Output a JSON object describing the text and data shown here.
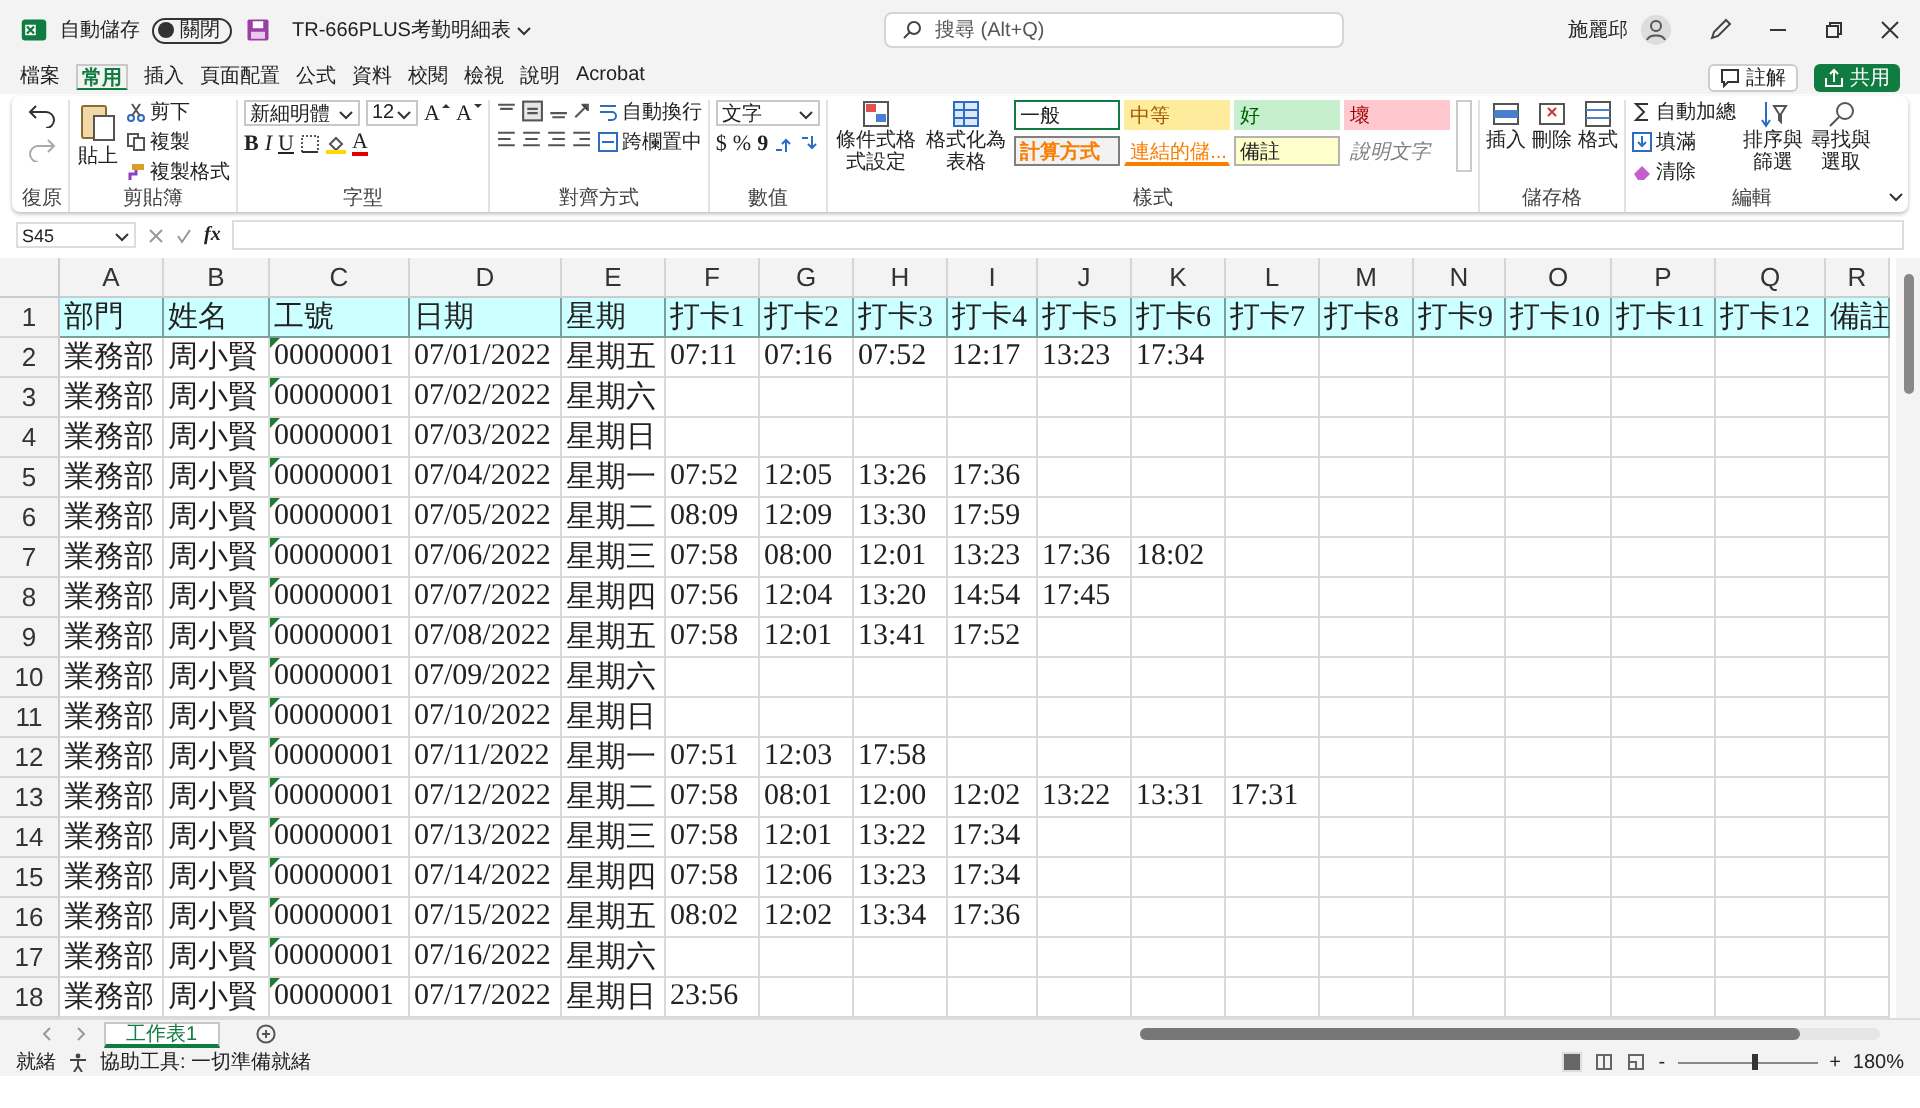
{
  "title_bar": {
    "autosave": {
      "label": "自動儲存",
      "on": false,
      "state_text": "關閉"
    },
    "filename": "TR-666PLUS考勤明細表",
    "search": {
      "placeholder": "搜尋 (Alt+Q)"
    },
    "user_name": "施麗邱"
  },
  "menu_tabs": [
    {
      "label": "檔案",
      "selected": false
    },
    {
      "label": "常用",
      "selected": true
    },
    {
      "label": "插入",
      "selected": false
    },
    {
      "label": "頁面配置",
      "selected": false
    },
    {
      "label": "公式",
      "selected": false
    },
    {
      "label": "資料",
      "selected": false
    },
    {
      "label": "校閱",
      "selected": false
    },
    {
      "label": "檢視",
      "selected": false
    },
    {
      "label": "說明",
      "selected": false
    },
    {
      "label": "Acrobat",
      "selected": false
    }
  ],
  "comments_button": "註解",
  "share_button": "共用",
  "ribbon": {
    "undo": {
      "label": "復原"
    },
    "clipboard": {
      "paste": "貼上",
      "cut": "剪下",
      "copy": "複製",
      "format_painter": "複製格式",
      "label": "剪貼簿"
    },
    "font": {
      "name": "新細明體",
      "size": "12",
      "grow": "A",
      "shrink": "A",
      "bold": "B",
      "italic": "I",
      "underline": "U",
      "font_color": "A",
      "label": "字型"
    },
    "alignment": {
      "wrap_text": "自動換行",
      "merge_center": "跨欄置中",
      "label": "對齊方式"
    },
    "number": {
      "format": "文字",
      "currency": "$",
      "percent": "%",
      "comma": "9",
      "label": "數值"
    },
    "styles": {
      "conditional": "條件式格式設定",
      "as_table": "格式化為表格",
      "label": "樣式",
      "gallery": [
        {
          "label": "一般",
          "kind": "normal",
          "selected": true
        },
        {
          "label": "中等",
          "kind": "neutral",
          "selected": false
        },
        {
          "label": "好",
          "kind": "good",
          "selected": false
        },
        {
          "label": "壞",
          "kind": "bad",
          "selected": false
        },
        {
          "label": "計算方式",
          "kind": "calculation",
          "selected": false
        },
        {
          "label": "連結的儲...",
          "kind": "linked",
          "selected": false
        },
        {
          "label": "備註",
          "kind": "note",
          "selected": false
        },
        {
          "label": "說明文字",
          "kind": "explanatory",
          "selected": false
        }
      ]
    },
    "cells": {
      "insert": "插入",
      "delete": "刪除",
      "format": "格式",
      "label": "儲存格"
    },
    "editing": {
      "autosum": "自動加總",
      "fill": "填滿",
      "clear": "清除",
      "sort_filter": "排序與篩選",
      "find_select": "尋找與選取",
      "label": "編輯"
    }
  },
  "formula_bar": {
    "name_box": "S45",
    "function_label": "fx"
  },
  "sheet": {
    "columns": [
      {
        "label": "A",
        "flagged": false
      },
      {
        "label": "B",
        "flagged": false
      },
      {
        "label": "C",
        "flagged": true
      },
      {
        "label": "D",
        "flagged": false
      },
      {
        "label": "E",
        "flagged": false
      },
      {
        "label": "F",
        "flagged": false
      },
      {
        "label": "G",
        "flagged": false
      },
      {
        "label": "H",
        "flagged": false
      },
      {
        "label": "I",
        "flagged": false
      },
      {
        "label": "J",
        "flagged": false
      },
      {
        "label": "K",
        "flagged": false
      },
      {
        "label": "L",
        "flagged": false
      },
      {
        "label": "M",
        "flagged": false
      },
      {
        "label": "N",
        "flagged": false
      },
      {
        "label": "O",
        "flagged": false
      },
      {
        "label": "P",
        "flagged": false
      },
      {
        "label": "Q",
        "flagged": false
      },
      {
        "label": "R",
        "flagged": false
      }
    ],
    "rows": [
      {
        "number": "1",
        "highlighted": true,
        "cells": [
          "部門",
          "姓名",
          "工號",
          "日期",
          "星期",
          "打卡1",
          "打卡2",
          "打卡3",
          "打卡4",
          "打卡5",
          "打卡6",
          "打卡7",
          "打卡8",
          "打卡9",
          "打卡10",
          "打卡11",
          "打卡12",
          "備註"
        ]
      },
      {
        "number": "2",
        "highlighted": false,
        "cells": [
          "業務部",
          "周小賢",
          "00000001",
          "07/01/2022",
          "星期五",
          "07:11",
          "07:16",
          "07:52",
          "12:17",
          "13:23",
          "17:34"
        ]
      },
      {
        "number": "3",
        "highlighted": false,
        "cells": [
          "業務部",
          "周小賢",
          "00000001",
          "07/02/2022",
          "星期六"
        ]
      },
      {
        "number": "4",
        "highlighted": false,
        "cells": [
          "業務部",
          "周小賢",
          "00000001",
          "07/03/2022",
          "星期日"
        ]
      },
      {
        "number": "5",
        "highlighted": false,
        "cells": [
          "業務部",
          "周小賢",
          "00000001",
          "07/04/2022",
          "星期一",
          "07:52",
          "12:05",
          "13:26",
          "17:36"
        ]
      },
      {
        "number": "6",
        "highlighted": false,
        "cells": [
          "業務部",
          "周小賢",
          "00000001",
          "07/05/2022",
          "星期二",
          "08:09",
          "12:09",
          "13:30",
          "17:59"
        ]
      },
      {
        "number": "7",
        "highlighted": false,
        "cells": [
          "業務部",
          "周小賢",
          "00000001",
          "07/06/2022",
          "星期三",
          "07:58",
          "08:00",
          "12:01",
          "13:23",
          "17:36",
          "18:02"
        ]
      },
      {
        "number": "8",
        "highlighted": false,
        "cells": [
          "業務部",
          "周小賢",
          "00000001",
          "07/07/2022",
          "星期四",
          "07:56",
          "12:04",
          "13:20",
          "14:54",
          "17:45"
        ]
      },
      {
        "number": "9",
        "highlighted": false,
        "cells": [
          "業務部",
          "周小賢",
          "00000001",
          "07/08/2022",
          "星期五",
          "07:58",
          "12:01",
          "13:41",
          "17:52"
        ]
      },
      {
        "number": "10",
        "highlighted": false,
        "cells": [
          "業務部",
          "周小賢",
          "00000001",
          "07/09/2022",
          "星期六"
        ]
      },
      {
        "number": "11",
        "highlighted": false,
        "cells": [
          "業務部",
          "周小賢",
          "00000001",
          "07/10/2022",
          "星期日"
        ]
      },
      {
        "number": "12",
        "highlighted": false,
        "cells": [
          "業務部",
          "周小賢",
          "00000001",
          "07/11/2022",
          "星期一",
          "07:51",
          "12:03",
          "17:58"
        ]
      },
      {
        "number": "13",
        "highlighted": false,
        "cells": [
          "業務部",
          "周小賢",
          "00000001",
          "07/12/2022",
          "星期二",
          "07:58",
          "08:01",
          "12:00",
          "12:02",
          "13:22",
          "13:31",
          "17:31"
        ]
      },
      {
        "number": "14",
        "highlighted": false,
        "cells": [
          "業務部",
          "周小賢",
          "00000001",
          "07/13/2022",
          "星期三",
          "07:58",
          "12:01",
          "13:22",
          "17:34"
        ]
      },
      {
        "number": "15",
        "highlighted": false,
        "cells": [
          "業務部",
          "周小賢",
          "00000001",
          "07/14/2022",
          "星期四",
          "07:58",
          "12:06",
          "13:23",
          "17:34"
        ]
      },
      {
        "number": "16",
        "highlighted": false,
        "cells": [
          "業務部",
          "周小賢",
          "00000001",
          "07/15/2022",
          "星期五",
          "08:02",
          "12:02",
          "13:34",
          "17:36"
        ]
      },
      {
        "number": "17",
        "highlighted": false,
        "cells": [
          "業務部",
          "周小賢",
          "00000001",
          "07/16/2022",
          "星期六"
        ]
      },
      {
        "number": "18",
        "highlighted": false,
        "cells": [
          "業務部",
          "周小賢",
          "00000001",
          "07/17/2022",
          "星期日",
          "23:56"
        ]
      }
    ]
  },
  "sheet_tabs": [
    {
      "label": "工作表1",
      "selected": true
    }
  ],
  "status_bar": {
    "ready": "就緒",
    "accessibility": "協助工具: 一切準備就緒",
    "zoom": {
      "zoom_out": "-",
      "level": 0.55,
      "zoom_in": "+",
      "percent": "180%"
    }
  }
}
